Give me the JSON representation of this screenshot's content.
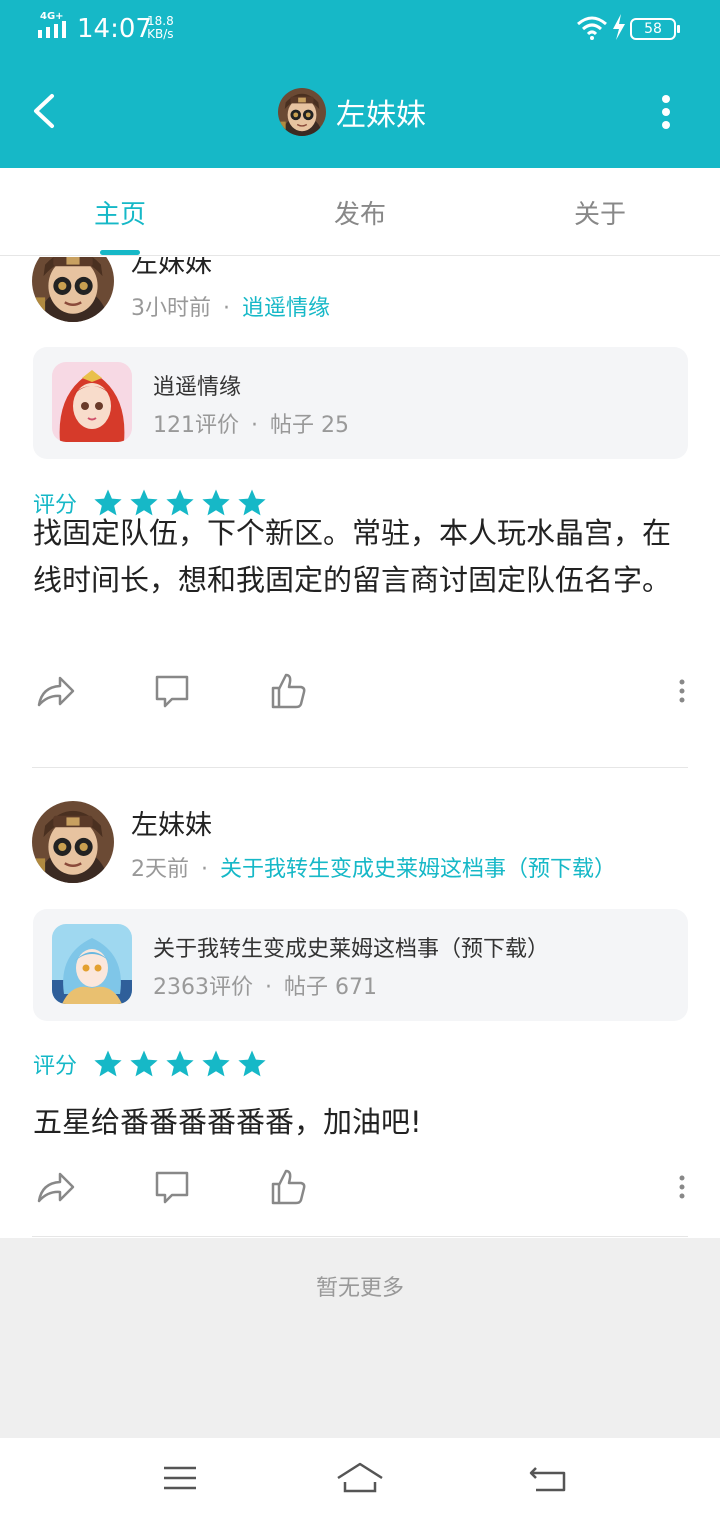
{
  "status_bar": {
    "network": "4G+",
    "time": "14:07",
    "speed_value": "18.8",
    "speed_unit": "KB/s",
    "battery": "58"
  },
  "header": {
    "title": "左妹妹"
  },
  "tabs": [
    {
      "label": "主页",
      "active": true
    },
    {
      "label": "发布",
      "active": false
    },
    {
      "label": "关于",
      "active": false
    }
  ],
  "posts": [
    {
      "author": "左妹妹",
      "time_ago": "3小时前",
      "game_link": "逍遥情缘",
      "game_card": {
        "name": "逍遥情缘",
        "reviews": "121评价",
        "posts": "帖子 25"
      },
      "rating_label": "评分",
      "stars": 5,
      "content": "找固定队伍，下个新区。常驻，本人玩水晶宫，在线时间长，想和我固定的留言商讨固定队伍名字。"
    },
    {
      "author": "左妹妹",
      "time_ago": "2天前",
      "game_link": "关于我转生变成史莱姆这档事（预下载）",
      "game_card": {
        "name": "关于我转生变成史莱姆这档事（预下载）",
        "reviews": "2363评价",
        "posts": "帖子 671"
      },
      "rating_label": "评分",
      "stars": 5,
      "content": "五星给番番番番番番，加油吧!"
    }
  ],
  "footer": {
    "empty_text": "暂无更多"
  },
  "colors": {
    "accent": "#16b8c7",
    "muted": "#999999",
    "card_bg": "#f4f5f7",
    "empty_bg": "#efefef"
  }
}
